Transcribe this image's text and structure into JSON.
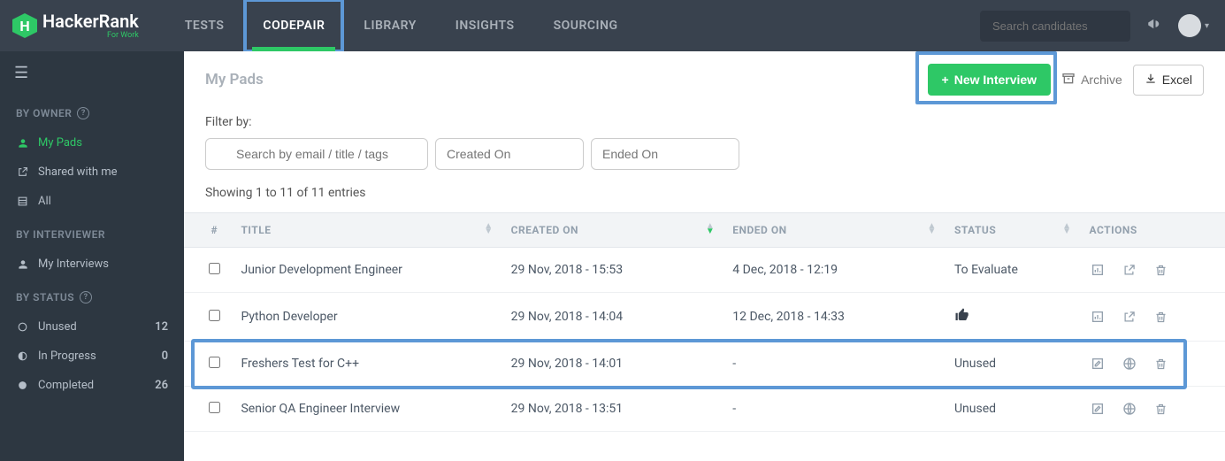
{
  "header": {
    "brand_main": "HackerRank",
    "brand_sub": "For Work",
    "tabs": {
      "tests": "TESTS",
      "codepair": "CODEPAIR",
      "library": "LIBRARY",
      "insights": "INSIGHTS",
      "sourcing": "SOURCING"
    },
    "search_placeholder": "Search candidates"
  },
  "sidebar": {
    "by_owner": "BY OWNER",
    "my_pads": "My Pads",
    "shared": "Shared with me",
    "all": "All",
    "by_interviewer": "BY INTERVIEWER",
    "my_interviews": "My Interviews",
    "by_status": "BY STATUS",
    "status": [
      {
        "label": "Unused",
        "count": "12"
      },
      {
        "label": "In Progress",
        "count": "0"
      },
      {
        "label": "Completed",
        "count": "26"
      }
    ]
  },
  "main": {
    "title": "My Pads",
    "new_interview": "New Interview",
    "archive": "Archive",
    "excel": "Excel",
    "filter_by": "Filter by:",
    "search_placeholder": "Search by email / title / tags",
    "created_on_placeholder": "Created On",
    "ended_on_placeholder": "Ended On",
    "showing": "Showing 1 to 11 of 11 entries",
    "columns": {
      "num": "#",
      "title": "TITLE",
      "created": "CREATED ON",
      "ended": "ENDED ON",
      "status": "STATUS",
      "actions": "ACTIONS"
    },
    "rows": [
      {
        "title": "Junior Development Engineer",
        "created": "29 Nov, 2018 - 15:53",
        "ended": "4 Dec, 2018 - 12:19",
        "status": "To Evaluate",
        "thumb": false,
        "mode": "done"
      },
      {
        "title": "Python Developer",
        "created": "29 Nov, 2018 - 14:04",
        "ended": "12 Dec, 2018 - 14:33",
        "status": "",
        "thumb": true,
        "mode": "done"
      },
      {
        "title": "Freshers Test for C++",
        "created": "29 Nov, 2018 - 14:01",
        "ended": "-",
        "status": "Unused",
        "thumb": false,
        "mode": "unused"
      },
      {
        "title": "Senior QA Engineer Interview",
        "created": "29 Nov, 2018 - 13:51",
        "ended": "-",
        "status": "Unused",
        "thumb": false,
        "mode": "unused"
      }
    ]
  }
}
